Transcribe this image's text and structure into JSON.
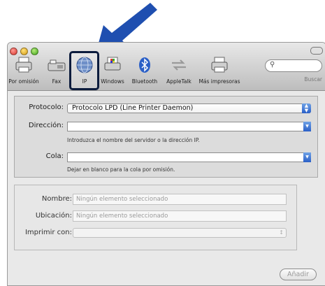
{
  "toolbar": {
    "items": [
      {
        "label": "Por omisión",
        "icon": "printer-icon"
      },
      {
        "label": "Fax",
        "icon": "fax-icon"
      },
      {
        "label": "IP",
        "icon": "globe-icon"
      },
      {
        "label": "Windows",
        "icon": "windows-printer-icon"
      },
      {
        "label": "Bluetooth",
        "icon": "bluetooth-icon"
      },
      {
        "label": "AppleTalk",
        "icon": "appletalk-icon"
      },
      {
        "label": "Más impresoras",
        "icon": "printer-icon"
      }
    ],
    "selected": "IP",
    "search_label": "Buscar"
  },
  "form": {
    "protocol_label": "Protocolo:",
    "protocol_value": "Protocolo LPD (Line Printer Daemon)",
    "address_label": "Dirección:",
    "address_value": "",
    "address_hint": "Introduzca el nombre del servidor o la dirección IP.",
    "queue_label": "Cola:",
    "queue_value": "",
    "queue_hint": "Dejar en blanco para la cola por omisión."
  },
  "details": {
    "name_label": "Nombre:",
    "name_value": "Ningún elemento seleccionado",
    "location_label": "Ubicación:",
    "location_value": "Ningún elemento seleccionado",
    "print_with_label": "Imprimir con:",
    "print_with_value": ""
  },
  "footer": {
    "add_label": "Añadir"
  },
  "colors": {
    "arrow": "#1f4fb0",
    "highlight_border": "#0c1c3d",
    "stepper": "#2a5fc7"
  }
}
